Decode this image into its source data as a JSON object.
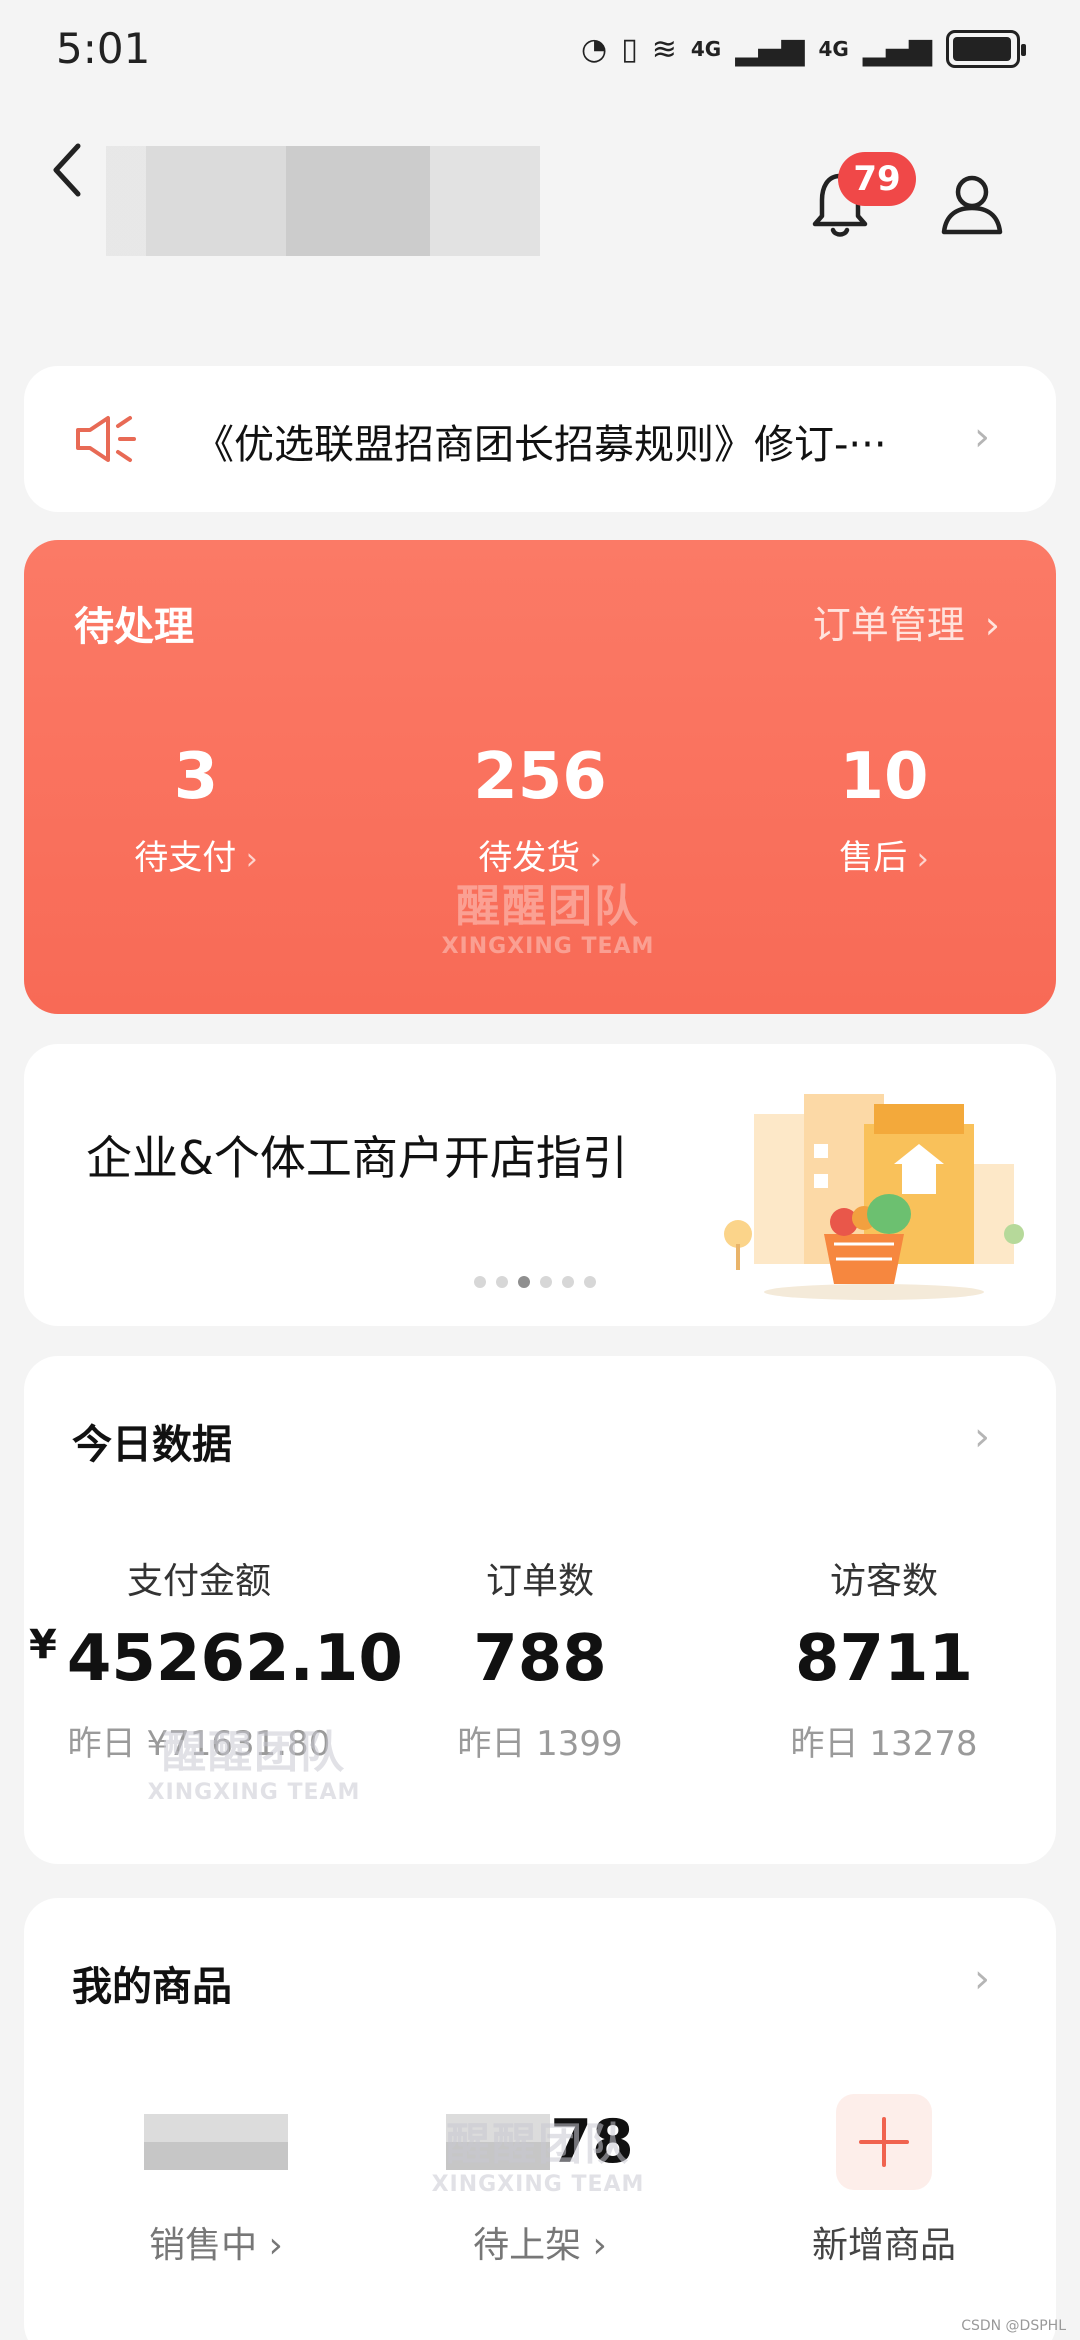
{
  "status_bar": {
    "time": "5:01",
    "network_1": "4G",
    "network_2": "4G"
  },
  "header": {
    "notification_count": "79"
  },
  "notice": {
    "text": "《优选联盟招商团长招募规则》修订-···"
  },
  "pending": {
    "title": "待处理",
    "link": "订单管理",
    "items": [
      {
        "value": "3",
        "label": "待支付"
      },
      {
        "value": "256",
        "label": "待发货"
      },
      {
        "value": "10",
        "label": "售后"
      }
    ]
  },
  "banner": {
    "text": "企业&个体工商户开店指引",
    "active_dot_index": 2,
    "dot_count": 6
  },
  "today_data": {
    "title": "今日数据",
    "items": [
      {
        "label": "支付金额",
        "currency": "¥",
        "value": "45262.10",
        "yesterday": "昨日 ¥71631.80"
      },
      {
        "label": "订单数",
        "value": "788",
        "yesterday": "昨日 1399"
      },
      {
        "label": "访客数",
        "value": "8711",
        "yesterday": "昨日 13278"
      }
    ]
  },
  "my_products": {
    "title": "我的商品",
    "items": [
      {
        "label": "销售中"
      },
      {
        "label": "待上架",
        "value_visible": "78"
      },
      {
        "label": "新增商品"
      }
    ]
  },
  "watermark": {
    "cn": "醒醒团队",
    "en": "XINGXING TEAM"
  },
  "credit": "CSDN @DSPHL",
  "colors": {
    "accent": "#f86a56",
    "badge": "#f04848",
    "background": "#f4f4f4"
  }
}
